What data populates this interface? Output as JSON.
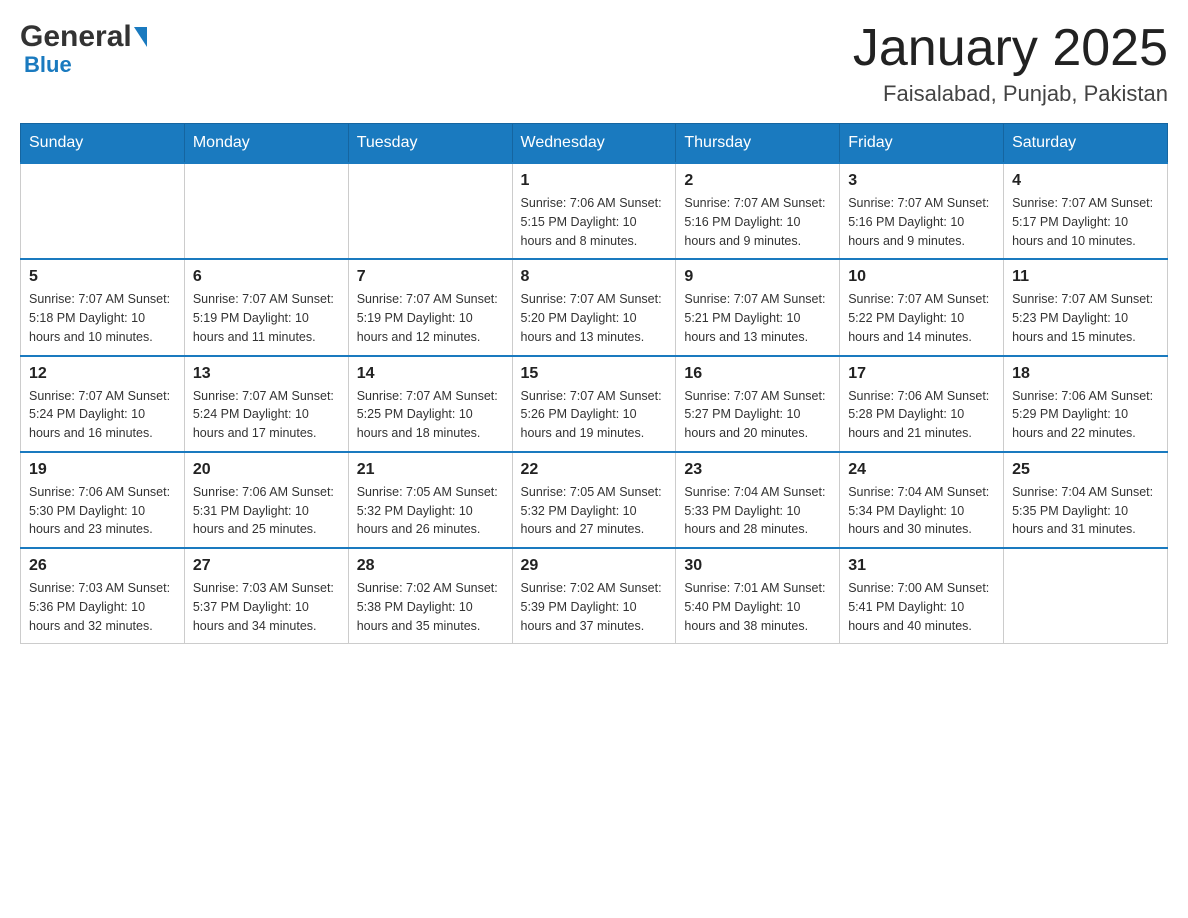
{
  "header": {
    "logo_general": "General",
    "logo_blue": "Blue",
    "month_title": "January 2025",
    "location": "Faisalabad, Punjab, Pakistan"
  },
  "columns": [
    "Sunday",
    "Monday",
    "Tuesday",
    "Wednesday",
    "Thursday",
    "Friday",
    "Saturday"
  ],
  "weeks": [
    {
      "cells": [
        {
          "day": "",
          "info": ""
        },
        {
          "day": "",
          "info": ""
        },
        {
          "day": "",
          "info": ""
        },
        {
          "day": "1",
          "info": "Sunrise: 7:06 AM\nSunset: 5:15 PM\nDaylight: 10 hours\nand 8 minutes."
        },
        {
          "day": "2",
          "info": "Sunrise: 7:07 AM\nSunset: 5:16 PM\nDaylight: 10 hours\nand 9 minutes."
        },
        {
          "day": "3",
          "info": "Sunrise: 7:07 AM\nSunset: 5:16 PM\nDaylight: 10 hours\nand 9 minutes."
        },
        {
          "day": "4",
          "info": "Sunrise: 7:07 AM\nSunset: 5:17 PM\nDaylight: 10 hours\nand 10 minutes."
        }
      ]
    },
    {
      "cells": [
        {
          "day": "5",
          "info": "Sunrise: 7:07 AM\nSunset: 5:18 PM\nDaylight: 10 hours\nand 10 minutes."
        },
        {
          "day": "6",
          "info": "Sunrise: 7:07 AM\nSunset: 5:19 PM\nDaylight: 10 hours\nand 11 minutes."
        },
        {
          "day": "7",
          "info": "Sunrise: 7:07 AM\nSunset: 5:19 PM\nDaylight: 10 hours\nand 12 minutes."
        },
        {
          "day": "8",
          "info": "Sunrise: 7:07 AM\nSunset: 5:20 PM\nDaylight: 10 hours\nand 13 minutes."
        },
        {
          "day": "9",
          "info": "Sunrise: 7:07 AM\nSunset: 5:21 PM\nDaylight: 10 hours\nand 13 minutes."
        },
        {
          "day": "10",
          "info": "Sunrise: 7:07 AM\nSunset: 5:22 PM\nDaylight: 10 hours\nand 14 minutes."
        },
        {
          "day": "11",
          "info": "Sunrise: 7:07 AM\nSunset: 5:23 PM\nDaylight: 10 hours\nand 15 minutes."
        }
      ]
    },
    {
      "cells": [
        {
          "day": "12",
          "info": "Sunrise: 7:07 AM\nSunset: 5:24 PM\nDaylight: 10 hours\nand 16 minutes."
        },
        {
          "day": "13",
          "info": "Sunrise: 7:07 AM\nSunset: 5:24 PM\nDaylight: 10 hours\nand 17 minutes."
        },
        {
          "day": "14",
          "info": "Sunrise: 7:07 AM\nSunset: 5:25 PM\nDaylight: 10 hours\nand 18 minutes."
        },
        {
          "day": "15",
          "info": "Sunrise: 7:07 AM\nSunset: 5:26 PM\nDaylight: 10 hours\nand 19 minutes."
        },
        {
          "day": "16",
          "info": "Sunrise: 7:07 AM\nSunset: 5:27 PM\nDaylight: 10 hours\nand 20 minutes."
        },
        {
          "day": "17",
          "info": "Sunrise: 7:06 AM\nSunset: 5:28 PM\nDaylight: 10 hours\nand 21 minutes."
        },
        {
          "day": "18",
          "info": "Sunrise: 7:06 AM\nSunset: 5:29 PM\nDaylight: 10 hours\nand 22 minutes."
        }
      ]
    },
    {
      "cells": [
        {
          "day": "19",
          "info": "Sunrise: 7:06 AM\nSunset: 5:30 PM\nDaylight: 10 hours\nand 23 minutes."
        },
        {
          "day": "20",
          "info": "Sunrise: 7:06 AM\nSunset: 5:31 PM\nDaylight: 10 hours\nand 25 minutes."
        },
        {
          "day": "21",
          "info": "Sunrise: 7:05 AM\nSunset: 5:32 PM\nDaylight: 10 hours\nand 26 minutes."
        },
        {
          "day": "22",
          "info": "Sunrise: 7:05 AM\nSunset: 5:32 PM\nDaylight: 10 hours\nand 27 minutes."
        },
        {
          "day": "23",
          "info": "Sunrise: 7:04 AM\nSunset: 5:33 PM\nDaylight: 10 hours\nand 28 minutes."
        },
        {
          "day": "24",
          "info": "Sunrise: 7:04 AM\nSunset: 5:34 PM\nDaylight: 10 hours\nand 30 minutes."
        },
        {
          "day": "25",
          "info": "Sunrise: 7:04 AM\nSunset: 5:35 PM\nDaylight: 10 hours\nand 31 minutes."
        }
      ]
    },
    {
      "cells": [
        {
          "day": "26",
          "info": "Sunrise: 7:03 AM\nSunset: 5:36 PM\nDaylight: 10 hours\nand 32 minutes."
        },
        {
          "day": "27",
          "info": "Sunrise: 7:03 AM\nSunset: 5:37 PM\nDaylight: 10 hours\nand 34 minutes."
        },
        {
          "day": "28",
          "info": "Sunrise: 7:02 AM\nSunset: 5:38 PM\nDaylight: 10 hours\nand 35 minutes."
        },
        {
          "day": "29",
          "info": "Sunrise: 7:02 AM\nSunset: 5:39 PM\nDaylight: 10 hours\nand 37 minutes."
        },
        {
          "day": "30",
          "info": "Sunrise: 7:01 AM\nSunset: 5:40 PM\nDaylight: 10 hours\nand 38 minutes."
        },
        {
          "day": "31",
          "info": "Sunrise: 7:00 AM\nSunset: 5:41 PM\nDaylight: 10 hours\nand 40 minutes."
        },
        {
          "day": "",
          "info": ""
        }
      ]
    }
  ]
}
